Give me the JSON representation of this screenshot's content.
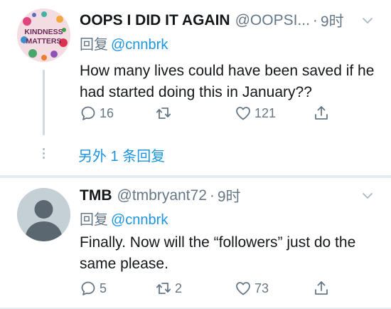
{
  "tweets": [
    {
      "display_name": "OOPS I DID IT AGAIN",
      "handle": "@OOPSI...",
      "separator": "·",
      "time": "9时",
      "reply_prefix": "回复",
      "reply_to": "@cnnbrk",
      "text": "How many lives could have been saved if he had started doing this in January??",
      "avatar_text": [
        "KINDNESS",
        "MATTERS"
      ],
      "replies": "16",
      "retweets": "",
      "likes": "121",
      "more_replies": "另外 1 条回复"
    },
    {
      "display_name": "TMB",
      "handle": "@tmbryant72",
      "separator": "·",
      "time": "9时",
      "reply_prefix": "回复",
      "reply_to": "@cnnbrk",
      "text": "Finally. Now will the “followers” just do the same please.",
      "replies": "5",
      "retweets": "2",
      "likes": "73"
    }
  ],
  "icons": {
    "reply": "speech-bubble-icon",
    "retweet": "retweet-icon",
    "like": "heart-icon",
    "share": "share-icon",
    "menu": "chevron-down-icon"
  },
  "colors": {
    "link": "#1b95e0",
    "secondary_text": "#657786",
    "separator": "#e6ecf0"
  }
}
